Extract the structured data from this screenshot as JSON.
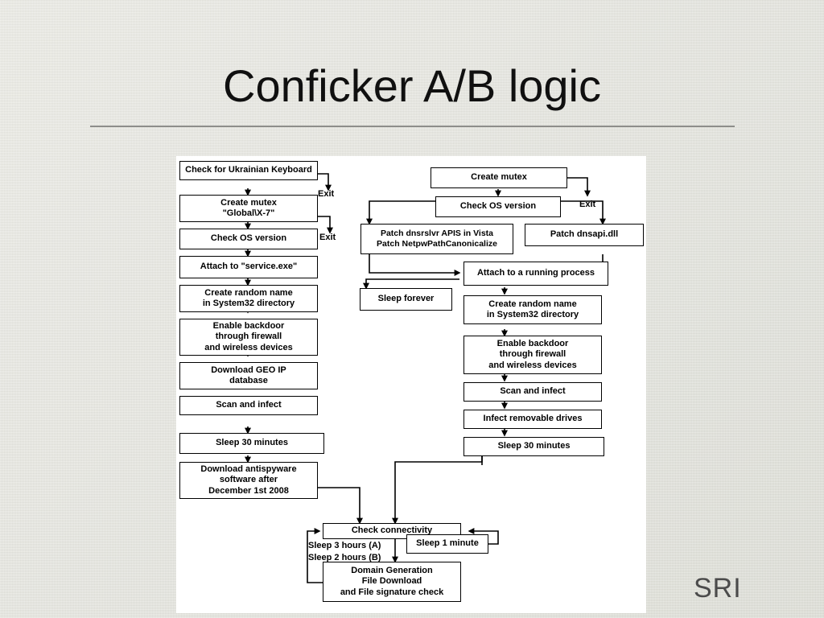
{
  "slide": {
    "title": "Conficker A/B logic",
    "logo": "SRI",
    "background_color": "#e4e4de",
    "panel_color": "#ffffff",
    "rule_color": "#8d8d8a",
    "logo_color": "#4b4b4b"
  },
  "diagram": {
    "branch_a": {
      "nodes": [
        {
          "id": "a1",
          "label": "Check for Ukrainian Keyboard"
        },
        {
          "id": "a2",
          "label": "Create mutex\n\"Global\\X-7\""
        },
        {
          "id": "a3",
          "label": "Check OS version"
        },
        {
          "id": "a4",
          "label": "Attach to \"service.exe\""
        },
        {
          "id": "a5",
          "label": "Create random name\nin System32 directory"
        },
        {
          "id": "a6",
          "label": "Enable backdoor\nthrough firewall\nand wireless devices"
        },
        {
          "id": "a7",
          "label": "Download GEO IP\ndatabase"
        },
        {
          "id": "a8",
          "label": "Scan and infect"
        },
        {
          "id": "a9",
          "label": "Sleep 30 minutes"
        },
        {
          "id": "a10",
          "label": "Download antispyware\nsoftware after\nDecember 1st 2008"
        }
      ],
      "exit_labels": [
        "Exit",
        "Exit"
      ]
    },
    "branch_b": {
      "nodes": [
        {
          "id": "b1",
          "label": "Create mutex"
        },
        {
          "id": "b2",
          "label": "Check OS version"
        },
        {
          "id": "b3",
          "label": "Patch dnsrslvr APIS in Vista\nPatch NetpwPathCanonicalize"
        },
        {
          "id": "b4",
          "label": "Patch dnsapi.dll"
        },
        {
          "id": "b5",
          "label": "Attach to a running process"
        },
        {
          "id": "b6",
          "label": "Sleep forever"
        },
        {
          "id": "b7",
          "label": "Create random name\nin System32 directory"
        },
        {
          "id": "b8",
          "label": "Enable backdoor\nthrough firewall\nand wireless devices"
        },
        {
          "id": "b9",
          "label": "Scan and infect"
        },
        {
          "id": "b10",
          "label": "Infect removable drives"
        },
        {
          "id": "b11",
          "label": "Sleep 30 minutes"
        }
      ],
      "exit_labels": [
        "Exit"
      ]
    },
    "shared": {
      "nodes": [
        {
          "id": "s1",
          "label": "Check connectivity"
        },
        {
          "id": "s2",
          "label": "Sleep 1 minute"
        },
        {
          "id": "s3",
          "label": "Domain Generation\nFile Download\nand File signature check"
        }
      ],
      "annotations": [
        {
          "id": "n1",
          "label": "Sleep 3 hours (A)\nSleep 2 hours (B)"
        }
      ]
    }
  }
}
